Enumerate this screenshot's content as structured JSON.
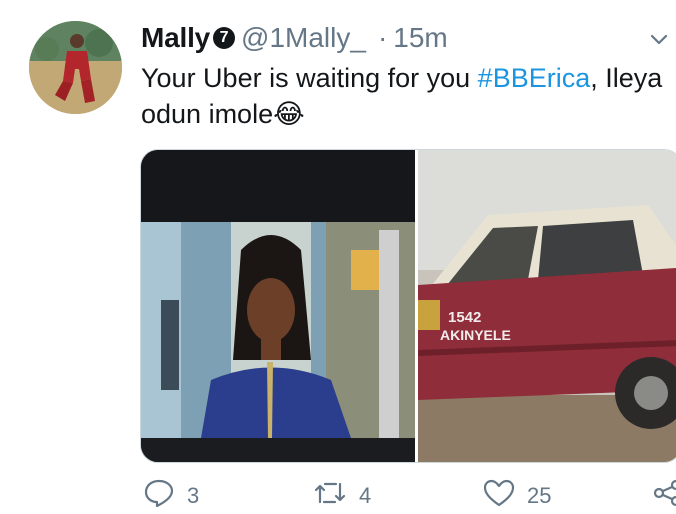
{
  "tweet": {
    "display_name": "Mally",
    "badge": "7",
    "handle": "@1Mally_",
    "separator": "·",
    "timestamp": "15m",
    "text_before": "Your Uber is waiting for you ",
    "hashtag": "#BBErica",
    "text_after": ", Ileya odun imole",
    "emoji": "😂"
  },
  "media": {
    "car_plate": "1542",
    "car_text": "AKINYELE"
  },
  "actions": {
    "reply_count": "3",
    "retweet_count": "4",
    "like_count": "25"
  },
  "icons": {
    "menu": "chevron-down-icon",
    "reply": "reply-icon",
    "retweet": "retweet-icon",
    "like": "heart-icon",
    "share": "share-icon"
  },
  "colors": {
    "text": "#14171a",
    "secondary": "#657786",
    "link": "#1b95e0",
    "border": "#ccd6dd"
  }
}
